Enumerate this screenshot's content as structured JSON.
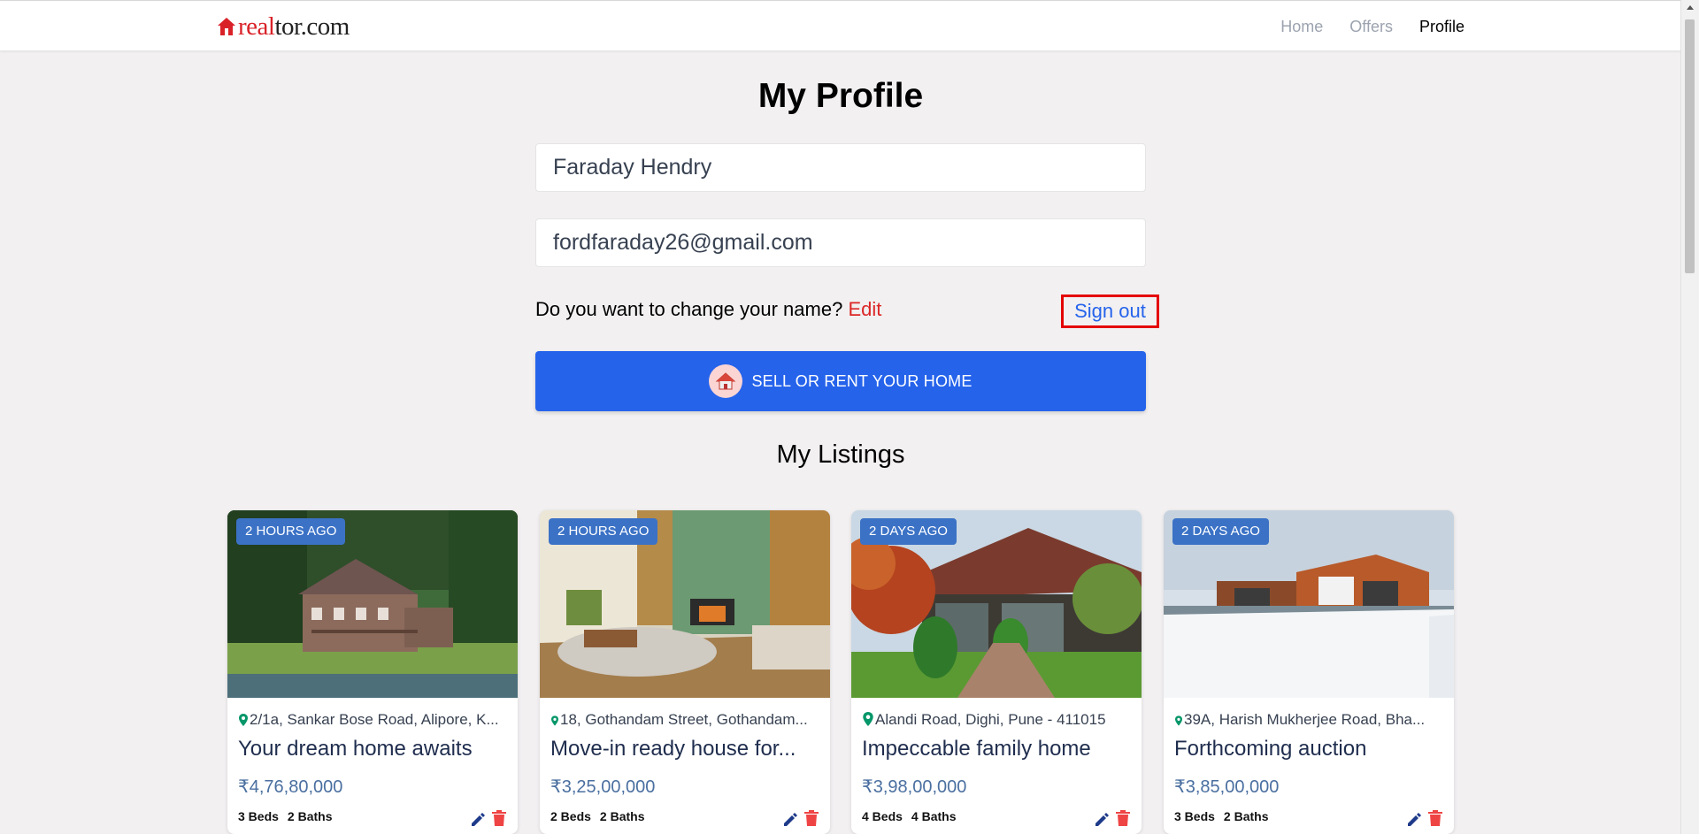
{
  "header": {
    "logo_real": "real",
    "logo_tor": "tor.com",
    "nav": [
      {
        "label": "Home"
      },
      {
        "label": "Offers"
      },
      {
        "label": "Profile"
      }
    ]
  },
  "profile": {
    "title": "My Profile",
    "name_value": "Faraday Hendry",
    "email_value": "fordfaraday26@gmail.com",
    "change_prompt": "Do you want to change your name?",
    "edit_label": "Edit",
    "signout_label": "Sign out",
    "sell_button_label": "SELL OR RENT YOUR HOME"
  },
  "listings": {
    "title": "My Listings",
    "items": [
      {
        "badge": "2 HOURS AGO",
        "address": "2/1a, Sankar Bose Road, Alipore, K...",
        "title": "Your dream home awaits",
        "price": "₹4,76,80,000",
        "beds": "3 Beds",
        "baths": "2 Baths"
      },
      {
        "badge": "2 HOURS AGO",
        "address": "18, Gothandam Street, Gothandam...",
        "title": "Move-in ready house for...",
        "price": "₹3,25,00,000",
        "beds": "2 Beds",
        "baths": "2 Baths"
      },
      {
        "badge": "2 DAYS AGO",
        "address": "Alandi Road, Dighi, Pune - 411015",
        "title": "Impeccable family home",
        "price": "₹3,98,00,000",
        "beds": "4 Beds",
        "baths": "4 Baths"
      },
      {
        "badge": "2 DAYS AGO",
        "address": "39A, Harish Mukherjee Road, Bha...",
        "title": "Forthcoming auction",
        "price": "₹3,85,00,000",
        "beds": "3 Beds",
        "baths": "2 Baths"
      }
    ]
  },
  "colors": {
    "accent": "#2563eb",
    "brand": "#d92228",
    "badge": "#3b72c6",
    "price": "#4a6fa0"
  },
  "icons": [
    "house-logo-icon",
    "house-icon",
    "location-pin-icon",
    "pencil-icon",
    "trash-icon"
  ]
}
